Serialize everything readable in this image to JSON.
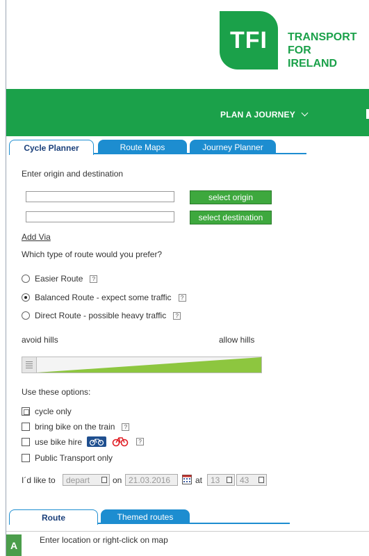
{
  "header": {
    "logo_mark": "TFI",
    "logo_lines": [
      "TRANSPORT",
      "FOR",
      "IRELAND"
    ],
    "nav_label": "PLAN A JOURNEY"
  },
  "tabs": [
    {
      "label": "Cycle Planner",
      "active": true
    },
    {
      "label": "Route Maps",
      "active": false
    },
    {
      "label": "Journey Planner",
      "active": false
    }
  ],
  "form": {
    "intro": "Enter origin and destination",
    "select_origin": "select origin",
    "select_destination": "select destination",
    "add_via": "Add Via",
    "route_question": "Which type of route would you prefer?",
    "route_options": [
      {
        "label": "Easier Route",
        "checked": false
      },
      {
        "label": "Balanced Route - expect some traffic",
        "checked": true
      },
      {
        "label": "Direct Route - possible heavy traffic",
        "checked": false
      }
    ],
    "help_glyph": "?",
    "slider": {
      "left_label": "avoid hills",
      "right_label": "allow hills",
      "value": 0.0
    },
    "options_heading": "Use these options:",
    "options": [
      {
        "label": "cycle only"
      },
      {
        "label": "bring bike on the train"
      },
      {
        "label": "use bike hire"
      },
      {
        "label": "Public Transport only"
      }
    ],
    "time": {
      "prefix": "I´d like to",
      "mode": "depart",
      "on": "on",
      "date": "21.03.2016",
      "at": "at",
      "hour": "13",
      "minute": "43"
    }
  },
  "bottom_tabs": [
    {
      "label": "Route",
      "active": true
    },
    {
      "label": "Themed routes",
      "active": false
    }
  ],
  "location": {
    "badge": "A",
    "hint": "Enter location or right-click on map"
  },
  "colors": {
    "brand_green": "#1ba14a",
    "tab_blue": "#1d8dd0",
    "button_green": "#3ea83e",
    "slider_green": "#8dc63f"
  }
}
